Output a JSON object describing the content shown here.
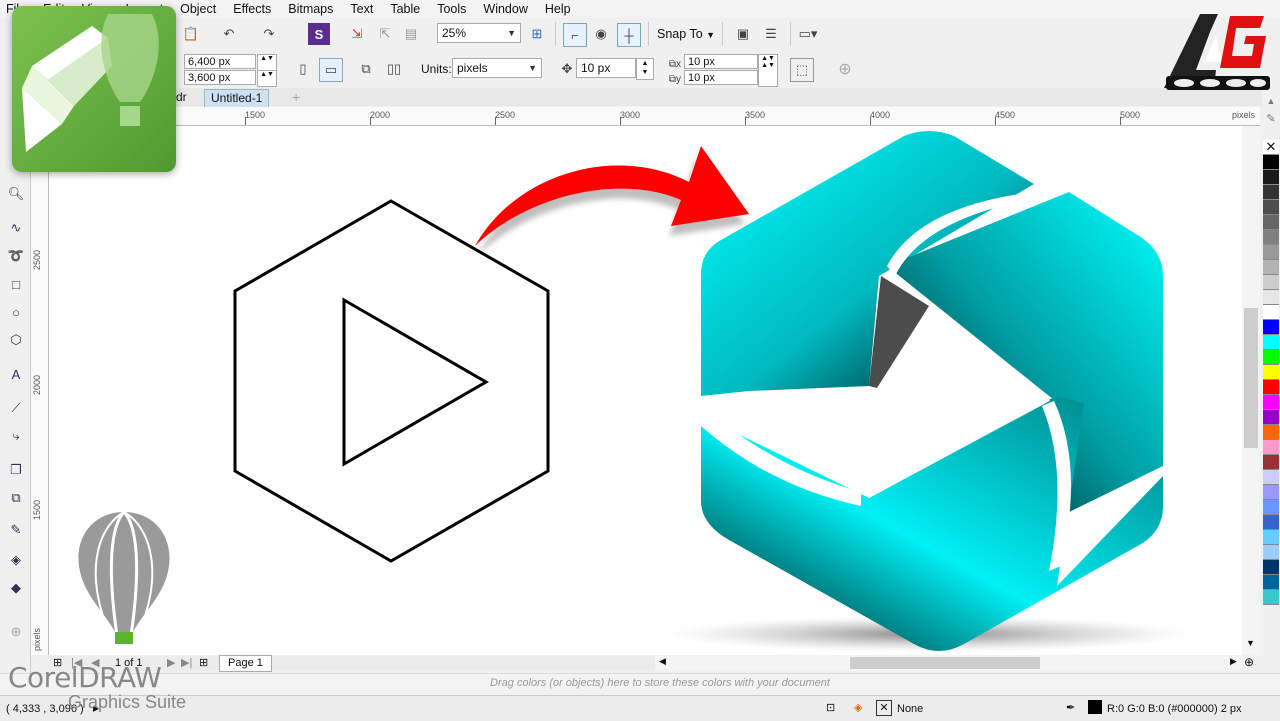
{
  "menu": [
    "File",
    "Edit",
    "View",
    "Layout",
    "Object",
    "Effects",
    "Bitmaps",
    "Text",
    "Table",
    "Tools",
    "Window",
    "Help"
  ],
  "toolbar": {
    "zoom_value": "25%",
    "snap_to_label": "Snap To"
  },
  "property_bar": {
    "width_value": "6,400 px",
    "height_value": "3,600 px",
    "units_label": "Units:",
    "units_value": "pixels",
    "nudge_value": "10 px",
    "dup_x_value": "10 px",
    "dup_y_value": "10 px"
  },
  "tabs": [
    {
      "label": "dr"
    },
    {
      "label": "Untitled-1"
    }
  ],
  "ruler": {
    "h_ticks": [
      "1500",
      "2000",
      "2500",
      "3000",
      "3500",
      "4000",
      "4500",
      "5000"
    ],
    "h_unit": "pixels",
    "v_ticks": [
      "2500",
      "2000",
      "1500"
    ],
    "v_unit": "pixels"
  },
  "page_nav": {
    "page_count": "1 of 1",
    "page_tab": "Page 1"
  },
  "docker_hint": "Drag colors (or objects) here to store these colors with your document",
  "status": {
    "coords": "( 4,333 , 3,096 )",
    "fill_label": "None",
    "outline_label": "R:0 G:0 B:0 (#000000)  2 px"
  },
  "overlay": {
    "brand_line1": "CorelDRAW",
    "brand_line2": "Graphics Suite"
  },
  "palette_colors": [
    "#000000",
    "#1a1a1a",
    "#333333",
    "#4d4d4d",
    "#666666",
    "#808080",
    "#999999",
    "#b3b3b3",
    "#cccccc",
    "#e6e6e6",
    "#ffffff",
    "#0000ff",
    "#00ffff",
    "#00ff00",
    "#ffff00",
    "#ff0000",
    "#ff00ff",
    "#9900cc",
    "#ff6600",
    "#ff99cc",
    "#993333",
    "#ccccff",
    "#9999ff",
    "#6699ff",
    "#3366cc",
    "#66ccff",
    "#99ccff",
    "#003366",
    "#006699",
    "#33cccc"
  ],
  "colors": {
    "accent_teal": "#00e5ee",
    "arrow_red": "#ff0000",
    "logo_green": "#5aa538"
  }
}
